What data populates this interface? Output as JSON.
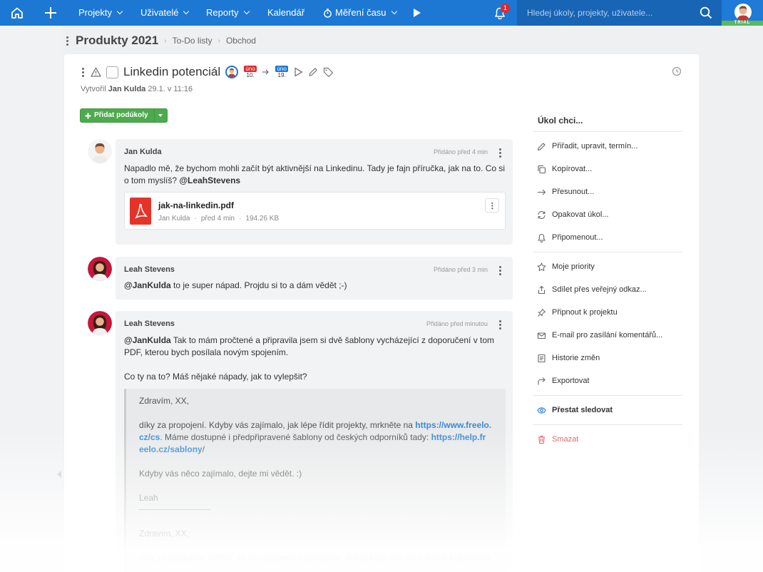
{
  "topbar": {
    "nav": [
      {
        "label": "Projekty",
        "has_dropdown": true
      },
      {
        "label": "Uživatelé",
        "has_dropdown": true
      },
      {
        "label": "Reporty",
        "has_dropdown": true
      },
      {
        "label": "Kalendář",
        "has_dropdown": false
      },
      {
        "label": "Měření času",
        "has_dropdown": true
      }
    ],
    "notification_count": "1",
    "search_placeholder": "Hledej úkoly, projekty, uživatele...",
    "trial_label": "TRIAL",
    "brand_color": "#1c78d3"
  },
  "breadcrumb": {
    "title": "Produkty 2021",
    "items": [
      "To-Do listy",
      "Obchod"
    ]
  },
  "task": {
    "title": "Linkedin potenciál",
    "start_date": {
      "month": "úno",
      "day": "10."
    },
    "due_date": {
      "month": "úno",
      "day": "19."
    },
    "created_prefix": "Vytvořil",
    "created_by": "Jan Kulda",
    "created_at": "29.1. v 11:16",
    "add_subtasks_label": "Přidat podúkoly"
  },
  "comments": [
    {
      "author": "Jan Kulda",
      "time": "Přidáno před 4 min",
      "text_line1": "Napadlo mě, že bychom mohli začít být aktivnější na Linkedinu. Tady je fajn příručka, jak na to. Co si",
      "text_line2_prefix": "o tom myslíš? ",
      "mention": "@LeahStevens",
      "attachment": {
        "name": "jak-na-linkedin.pdf",
        "author": "Jan Kulda",
        "time": "před 4 min",
        "size": "194.26 KB"
      }
    },
    {
      "author": "Leah Stevens",
      "time": "Přidáno před 3 min",
      "mention": "@JanKulda",
      "text": " to je super nápad. Projdu si to a dám vědět ;-)"
    },
    {
      "author": "Leah Stevens",
      "time": "Přidáno před minutou",
      "mention": "@JanKulda",
      "text_line1": " Tak to mám pročtené a připravila jsem si dvě šablony vycházející z doporučení v tom",
      "text_line2": "PDF, kterou bych posílala novým spojením.",
      "text_line3": "Co ty na to? Máš nějaké nápady, jak to vylepšit?",
      "quote": {
        "greeting": "Zdravím, XX,",
        "p1_line1": "díky za propojení. Kdyby vás zajímalo, jak lépe řídit projekty, mrkněte na ",
        "link1_part1": "https://www.freelo.",
        "link1_part2": "cz/cs",
        "p1_line2": ". Máme dostupné i předpřipravené šablony od českých odporníků tady: ",
        "link2_part1": "https://help.fr",
        "link2_part2": "eelo.cz/sablony",
        "link2_tail": "/",
        "p2": "Kdyby vás něco zajímalo, dejte mi vědět. :)",
        "signature": "Leah",
        "greeting2": "Zdravím, XX,",
        "p3": "díky za propojení. Věřím, že se vzájemně inspirujeme. Ráda bych vás na začátek inspirovala"
      }
    }
  ],
  "sidebar": {
    "heading": "Úkol chci...",
    "items": [
      {
        "label": "Přiřadit, upravit, termín...",
        "icon": "pencil-icon"
      },
      {
        "label": "Kopírovat...",
        "icon": "copy-icon"
      },
      {
        "label": "Přesunout...",
        "icon": "arrow-right-icon"
      },
      {
        "label": "Opakovat úkol...",
        "icon": "repeat-icon"
      },
      {
        "label": "Připomenout...",
        "icon": "bell-icon"
      },
      {
        "label": "Moje priority",
        "icon": "star-icon"
      },
      {
        "label": "Sdílet přes veřejný odkaz...",
        "icon": "share-icon"
      },
      {
        "label": "Připnout k projektu",
        "icon": "pin-icon"
      },
      {
        "label": "E-mail pro zasílání komentářů...",
        "icon": "email-icon"
      },
      {
        "label": "Historie změn",
        "icon": "history-icon"
      },
      {
        "label": "Exportovat",
        "icon": "export-icon"
      },
      {
        "label": "Přestat sledovat",
        "icon": "eye-icon"
      },
      {
        "label": "Smazat",
        "icon": "trash-icon"
      }
    ]
  },
  "colors": {
    "accent_green": "#4daa4d",
    "link_blue": "#3a8ad6",
    "danger_red": "#e05a5a",
    "date_red": "#e4262b",
    "date_blue": "#1c78d3"
  }
}
